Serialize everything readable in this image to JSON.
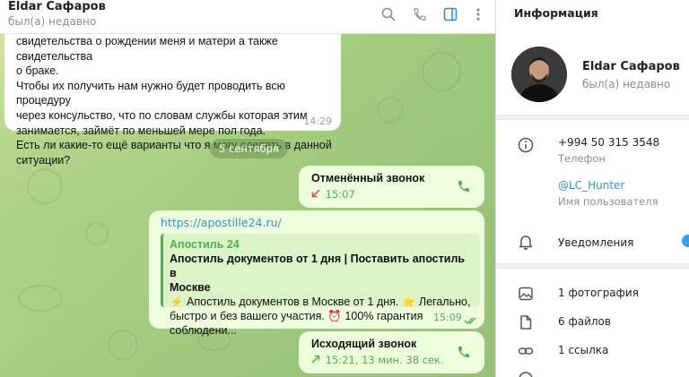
{
  "header": {
    "title": "Eldar Сафаров",
    "status": "был(а) недавно"
  },
  "messages": {
    "incoming": {
      "lines": [
        "свидетельства о рождении меня и матери а также свидетельства",
        "о браке.",
        "Чтобы их получить нам нужно будет проводить всю процедуру",
        "через консульство, что по словам службы которая этим",
        "занимается, займёт по меньшей мере пол года.",
        "Есть ли какие-то ещё варианты что я могу сделать в данной",
        "ситуации?"
      ],
      "time": "14:29"
    },
    "date_separator": "5 сентября",
    "missed_call": {
      "title": "Отменённый звонок",
      "time": "15:07"
    },
    "link_message": {
      "url": "https://apostille24.ru/",
      "preview_site": "Апостиль 24",
      "preview_title_1": "Апостиль документов от 1 дня | Поставить апостиль в",
      "preview_title_2": "Москве",
      "preview_desc_1": "⚡ Апостиль документов в Москве от 1 дня. ⭐ Легально,",
      "preview_desc_2": "быстро и без вашего участия. ⏰ 100% гарантия соблюдени...",
      "time": "15:09"
    },
    "outgoing_call": {
      "title": "Исходящий звонок",
      "meta": "15:21, 13 мин. 38 сек."
    }
  },
  "info": {
    "panel_title": "Информация",
    "name": "Eldar Сафаров",
    "status": "был(а) недавно",
    "phone": "+994 50 315 3548",
    "phone_label": "Телефон",
    "username": "@LC_Hunter",
    "username_label": "Имя пользователя",
    "notifications": "Уведомления",
    "media": [
      {
        "label": "1 фотография",
        "icon": "photo-icon"
      },
      {
        "label": "6 файлов",
        "icon": "file-icon"
      },
      {
        "label": "1 ссылка",
        "icon": "link-icon"
      }
    ]
  },
  "colors": {
    "accent_green": "#4fae4e",
    "link_blue": "#3a8fc8",
    "outgoing_bubble": "#eeffde"
  }
}
